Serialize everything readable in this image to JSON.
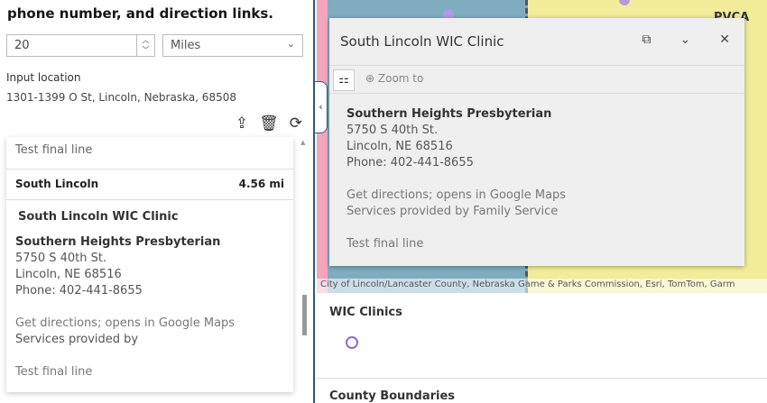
{
  "panel": {
    "title": "phone number, and direction links.",
    "distance": "20",
    "unit": "Miles",
    "input_label": "Input location",
    "input_value": "1301-1399 O St, Lincoln, Nebraska, 68508"
  },
  "results": {
    "prev_last_line": "Test final line",
    "group_name": "South Lincoln",
    "group_distance": "4.56 mi",
    "item_title": "South Lincoln WIC Clinic",
    "item_name": "Southern Heights Presbyterian",
    "address1": "5750 S 40th St.",
    "address2": "Lincoln, NE 68516",
    "phone": "Phone: 402-441-8655",
    "directions": "Get directions; opens in Google Maps",
    "services": "Services provided by",
    "last_line": "Test final line"
  },
  "popup": {
    "title": "South Lincoln WIC Clinic",
    "zoom_to": "Zoom to",
    "name": "Southern Heights Presbyterian",
    "address1": "5750 S 40th St.",
    "address2": "Lincoln, NE 68516",
    "phone": "Phone: 402-441-8655",
    "directions": "Get directions; opens in Google Maps",
    "services": "Services provided by Family Service",
    "last_line": "Test final line"
  },
  "map": {
    "label": "PVCA",
    "attribution": "City of Lincoln/Lancaster County, Nebraska Game & Parks Commission, Esri, TomTom, Garm"
  },
  "legend": {
    "layer1": "WIC Clinics",
    "layer2": "County Boundaries"
  }
}
